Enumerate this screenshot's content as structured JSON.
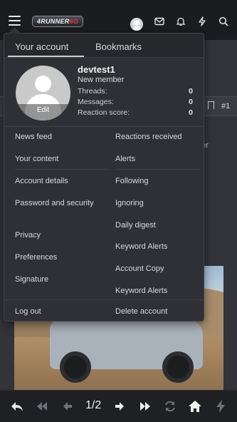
{
  "header": {
    "logo_text_a": "4RUNNER",
    "logo_text_b": "6G",
    "icons": [
      "menu-icon",
      "avatar-icon",
      "inbox-icon",
      "bell-icon",
      "lightning-icon",
      "search-icon"
    ]
  },
  "background": {
    "post_number": "#1",
    "partial_text": "er"
  },
  "menu": {
    "tabs": [
      {
        "label": "Your account",
        "active": true
      },
      {
        "label": "Bookmarks",
        "active": false
      }
    ],
    "profile": {
      "username": "devtest1",
      "user_title": "New member",
      "avatar_action": "Edit",
      "stats": [
        {
          "label": "Threads:",
          "value": "0"
        },
        {
          "label": "Messages:",
          "value": "0"
        },
        {
          "label": "Reaction score:",
          "value": "0"
        }
      ]
    },
    "left_links": [
      "News feed",
      "Your content",
      "Account details",
      "Password and security",
      "Privacy",
      "Preferences",
      "Signature"
    ],
    "right_links": [
      "Reactions received",
      "Alerts",
      "Following",
      "Ignoring",
      "Daily digest",
      "Keyword Alerts",
      "Account Copy",
      "Keyword Alerts"
    ],
    "logout": "Log out",
    "delete_account": "Delete account"
  },
  "toolbar": {
    "pager": "1/2",
    "icons": [
      "reply-icon",
      "first-page-icon",
      "prev-page-icon",
      "next-page-icon",
      "last-page-icon",
      "refresh-icon",
      "home-icon",
      "lightning-icon"
    ]
  },
  "colors": {
    "topbar": "#1b1c1f",
    "menu_bg": "#2e3035",
    "accent_red": "#e53935"
  }
}
